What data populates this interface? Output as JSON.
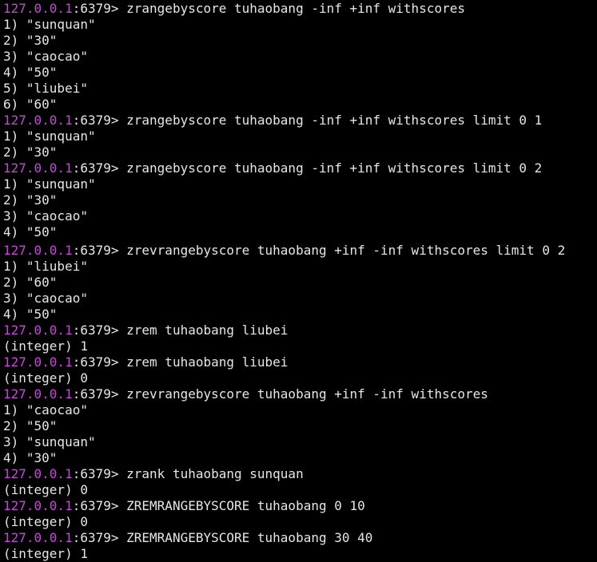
{
  "prompt": {
    "ip": "127.0.0.1",
    "port": ":6379> "
  },
  "colors": {
    "background": "#000000",
    "text": "#e6e6e6",
    "prompt_ip": "#c44ad6"
  },
  "lines": [
    {
      "type": "cmd",
      "text": "zrangebyscore tuhaobang -inf +inf withscores"
    },
    {
      "type": "out",
      "text": "1) \"sunquan\""
    },
    {
      "type": "out",
      "text": "2) \"30\""
    },
    {
      "type": "out",
      "text": "3) \"caocao\""
    },
    {
      "type": "out",
      "text": "4) \"50\""
    },
    {
      "type": "out",
      "text": "5) \"liubei\""
    },
    {
      "type": "out",
      "text": "6) \"60\""
    },
    {
      "type": "cmd",
      "text": "zrangebyscore tuhaobang -inf +inf withscores limit 0 1"
    },
    {
      "type": "out",
      "text": "1) \"sunquan\""
    },
    {
      "type": "out",
      "text": "2) \"30\""
    },
    {
      "type": "cmd",
      "text": "zrangebyscore tuhaobang -inf +inf withscores limit 0 2"
    },
    {
      "type": "out",
      "text": "1) \"sunquan\""
    },
    {
      "type": "out",
      "text": "2) \"30\""
    },
    {
      "type": "out",
      "text": "3) \"caocao\""
    },
    {
      "type": "out",
      "text": "4) \"50\"",
      "gap": true
    },
    {
      "type": "cmd",
      "text": "zrevrangebyscore tuhaobang +inf -inf withscores limit 0 2"
    },
    {
      "type": "out",
      "text": "1) \"liubei\""
    },
    {
      "type": "out",
      "text": "2) \"60\""
    },
    {
      "type": "out",
      "text": "3) \"caocao\""
    },
    {
      "type": "out",
      "text": "4) \"50\""
    },
    {
      "type": "cmd",
      "text": "zrem tuhaobang liubei"
    },
    {
      "type": "out",
      "text": "(integer) 1"
    },
    {
      "type": "cmd",
      "text": "zrem tuhaobang liubei"
    },
    {
      "type": "out",
      "text": "(integer) 0"
    },
    {
      "type": "cmd",
      "text": "zrevrangebyscore tuhaobang +inf -inf withscores"
    },
    {
      "type": "out",
      "text": "1) \"caocao\""
    },
    {
      "type": "out",
      "text": "2) \"50\""
    },
    {
      "type": "out",
      "text": "3) \"sunquan\""
    },
    {
      "type": "out",
      "text": "4) \"30\""
    },
    {
      "type": "cmd",
      "text": "zrank tuhaobang sunquan"
    },
    {
      "type": "out",
      "text": "(integer) 0"
    },
    {
      "type": "cmd",
      "text": "ZREMRANGEBYSCORE tuhaobang 0 10"
    },
    {
      "type": "out",
      "text": "(integer) 0"
    },
    {
      "type": "cmd",
      "text": "ZREMRANGEBYSCORE tuhaobang 30 40"
    },
    {
      "type": "out",
      "text": "(integer) 1"
    }
  ]
}
